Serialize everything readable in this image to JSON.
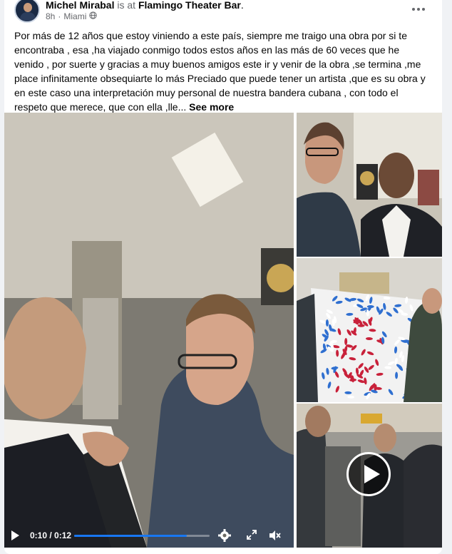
{
  "post": {
    "author": "Michel Mirabal",
    "is_at": "is at",
    "place": "Flamingo Theater Bar",
    "period": ".",
    "time": "8h",
    "dot": "·",
    "location": "Miami",
    "more_icon": "more-horizontal-icon",
    "text": "Por más de 12 años que estoy viniendo a este país, siempre me traigo una obra por si te encontraba , esa ,ha viajado conmigo todos estos años en las más de 60 veces que he venido , por suerte y gracias a muy buenos amigos este ir y venir de la obra ,se termina ,me place infinitamente obsequiarte lo más Preciado que puede tener un artista ,que es su obra y en este caso una interpretación muy personal de nuestra bandera cubana , con todo el respeto que merece, que con ella ,lle...",
    "see_more": "See more"
  },
  "video": {
    "time_display": "0:10 / 0:12",
    "progress": 0.83,
    "icons": [
      "play-icon",
      "settings-icon",
      "expand-icon",
      "volume-muted-icon"
    ]
  },
  "colors": {
    "accent": "#1877f2",
    "text": "#050505",
    "muted": "#65676b"
  }
}
